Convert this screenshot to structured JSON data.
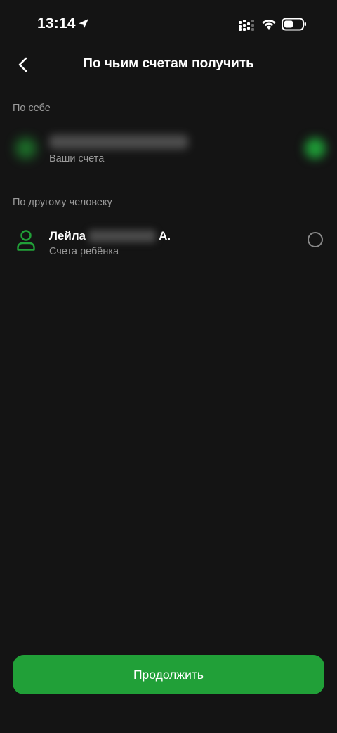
{
  "status_bar": {
    "time": "13:14"
  },
  "header": {
    "title": "По чьим счетам получить",
    "back_icon": "chevron-left-icon"
  },
  "sections": {
    "self": {
      "label": "По себе",
      "subtitle": "Ваши счета"
    },
    "other": {
      "label": "По другому человеку",
      "person": {
        "first_name": "Лейла",
        "initial": "А.",
        "subtitle": "Счета ребёнка",
        "icon": "person-icon"
      }
    }
  },
  "footer": {
    "continue_label": "Продолжить"
  },
  "colors": {
    "background": "#141414",
    "accent": "#21a038",
    "muted_text": "#9a9a9a"
  }
}
